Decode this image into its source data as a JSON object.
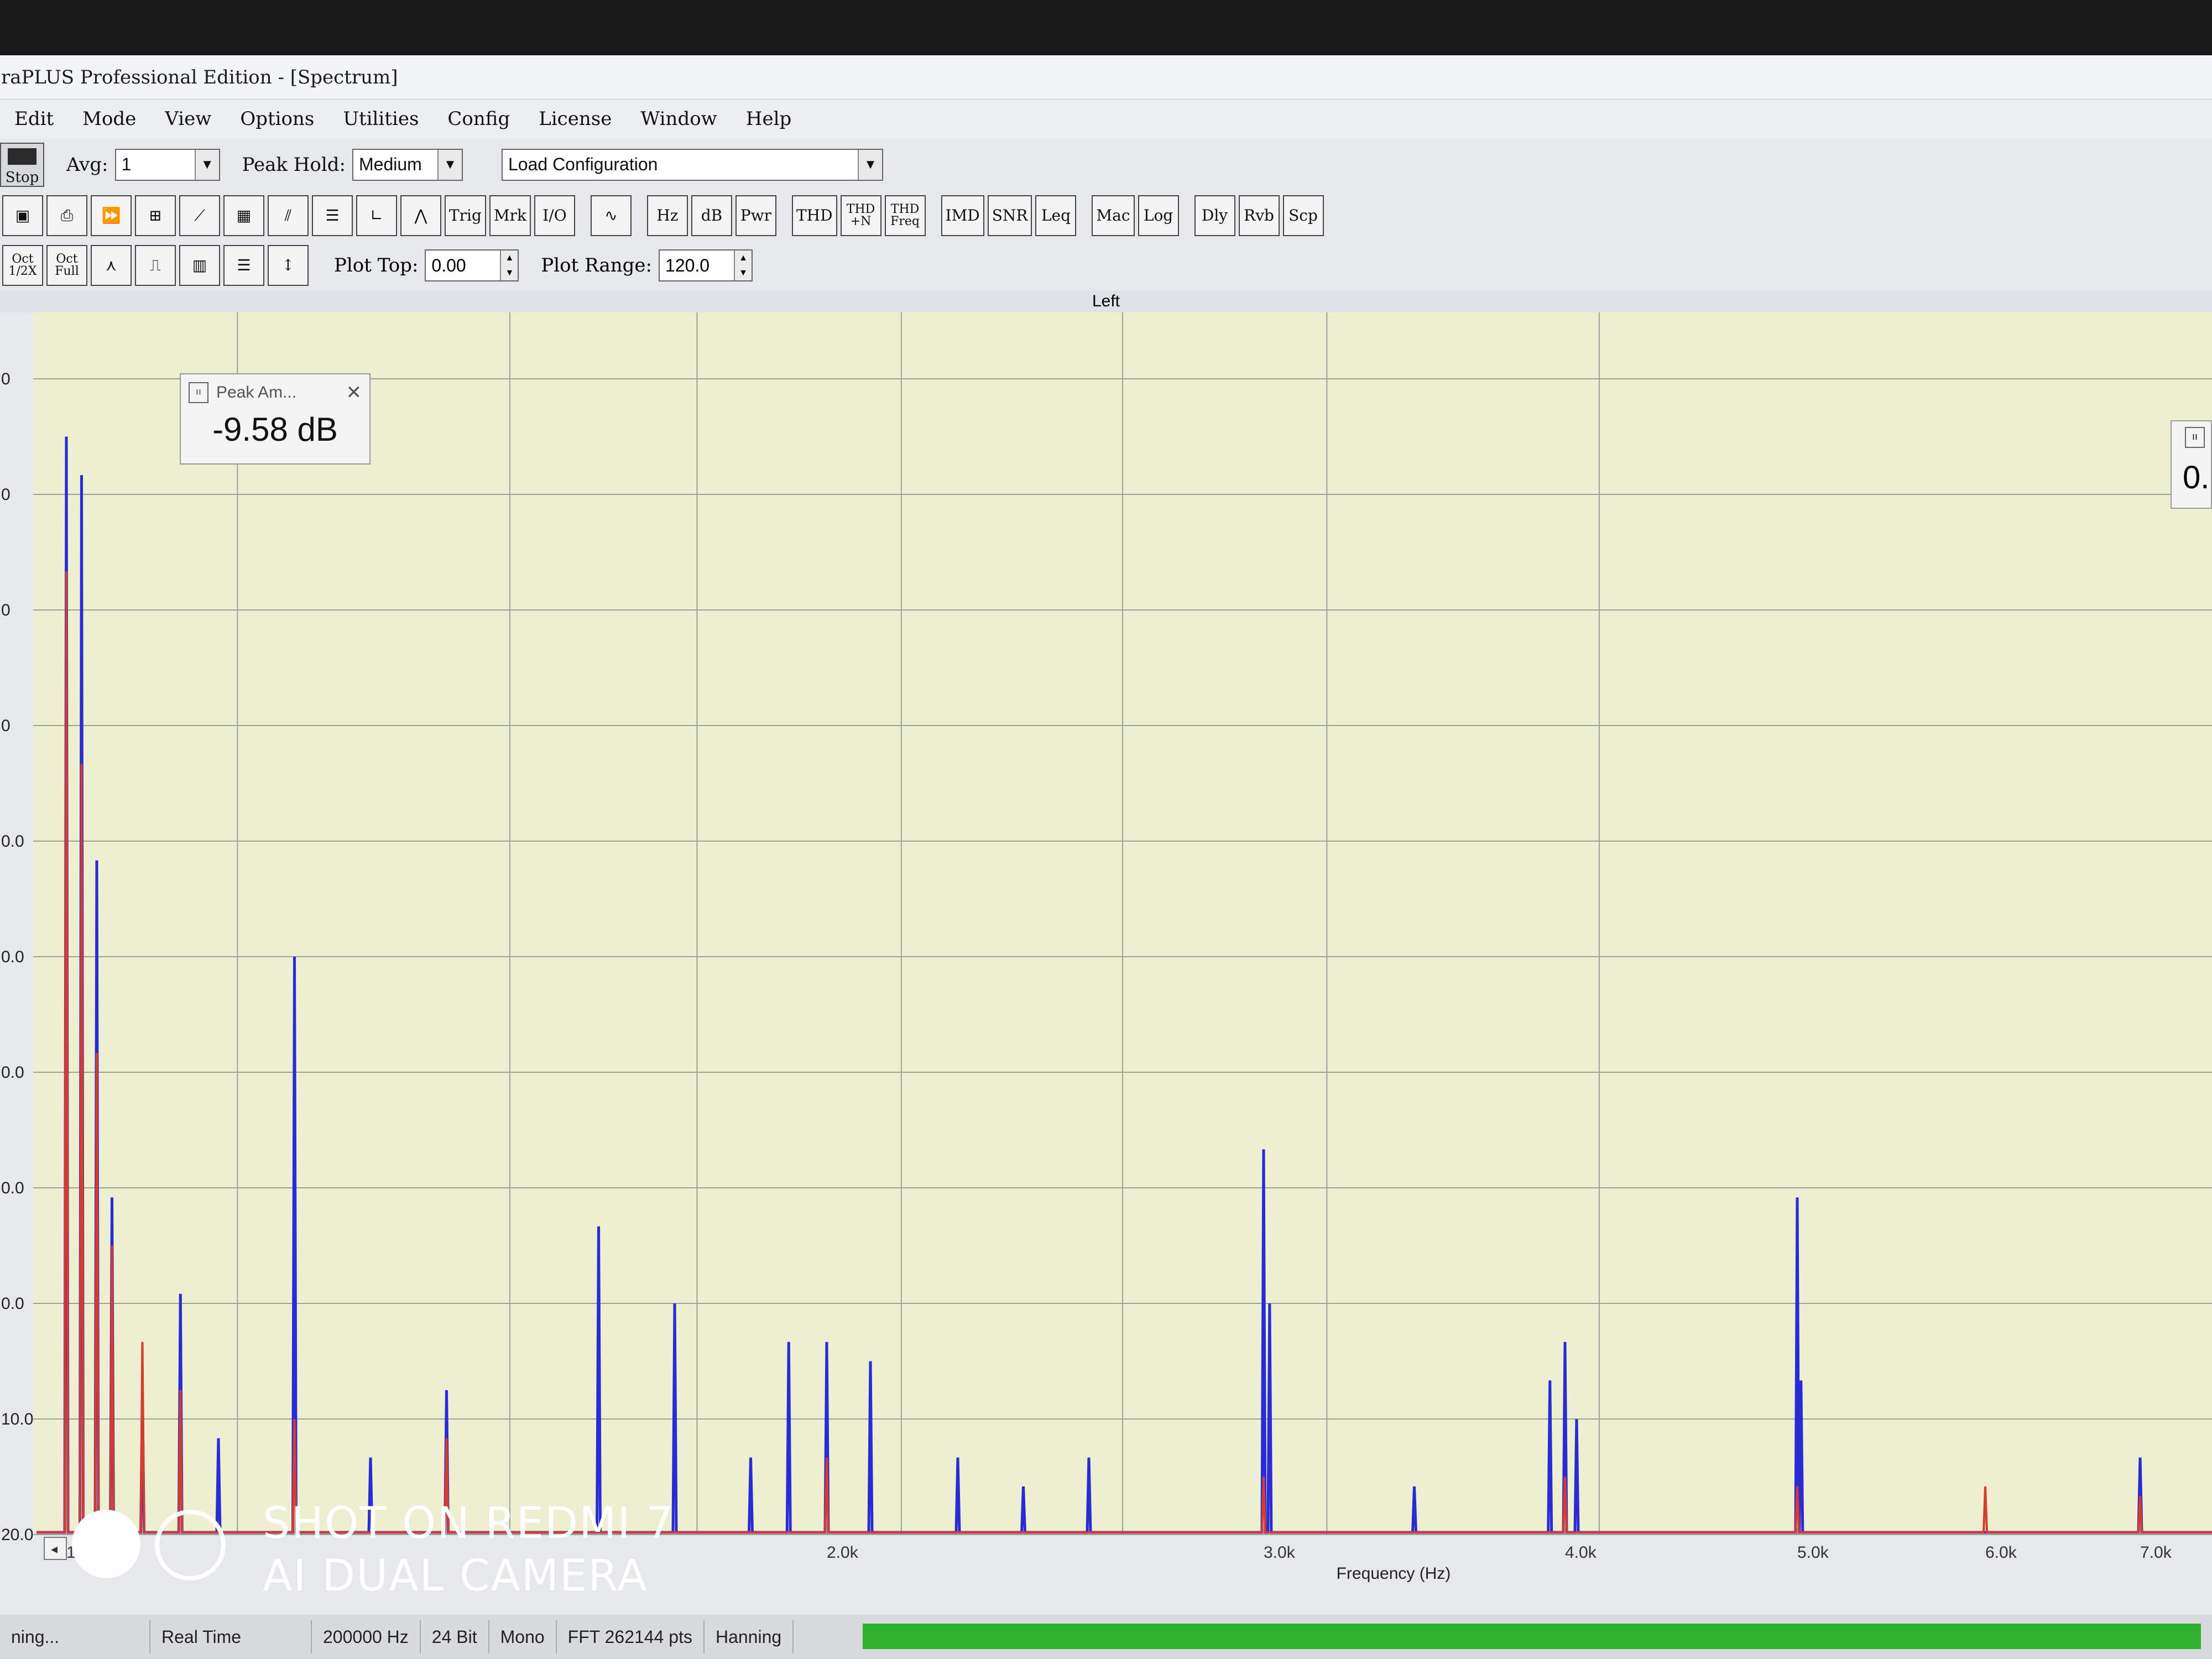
{
  "window": {
    "title": "raPLUS Professional Edition - [Spectrum]"
  },
  "menu": [
    "Edit",
    "Mode",
    "View",
    "Options",
    "Utilities",
    "Config",
    "License",
    "Window",
    "Help"
  ],
  "toolbar": {
    "stop_label": "Stop",
    "avg_label": "Avg:",
    "avg_value": "1",
    "peak_hold_label": "Peak Hold:",
    "peak_hold_value": "Medium",
    "config_value": "Load Configuration",
    "plot_top_label": "Plot Top:",
    "plot_top_value": "0.00",
    "plot_range_label": "Plot Range:",
    "plot_range_value": "120.0"
  },
  "tool_buttons_row2": [
    {
      "label": "",
      "icon": "save-icon"
    },
    {
      "label": "",
      "icon": "print-icon"
    },
    {
      "label": "",
      "icon": "fast-forward-icon"
    },
    {
      "label": "",
      "icon": "scope-icon"
    },
    {
      "label": "",
      "icon": "sawtooth-icon"
    },
    {
      "label": "",
      "icon": "spectrogram-icon"
    },
    {
      "label": "",
      "icon": "3d-plot-icon"
    },
    {
      "label": "",
      "icon": "list-icon"
    },
    {
      "label": "",
      "icon": "axis-icon"
    },
    {
      "label": "",
      "icon": "compass-icon"
    },
    {
      "label": "Trig",
      "icon": ""
    },
    {
      "label": "Mrk",
      "icon": ""
    },
    {
      "label": "I/O",
      "icon": ""
    },
    {
      "label": "",
      "icon": "sine-wave-icon"
    },
    {
      "label": "Hz",
      "icon": ""
    },
    {
      "label": "dB",
      "icon": ""
    },
    {
      "label": "Pwr",
      "icon": ""
    },
    {
      "label": "THD",
      "icon": ""
    },
    {
      "label": "THD +N",
      "icon": ""
    },
    {
      "label": "THD Freq",
      "icon": ""
    },
    {
      "label": "IMD",
      "icon": ""
    },
    {
      "label": "SNR",
      "icon": ""
    },
    {
      "label": "Leq",
      "icon": ""
    },
    {
      "label": "Mac",
      "icon": ""
    },
    {
      "label": "Log",
      "icon": ""
    },
    {
      "label": "Dly",
      "icon": ""
    },
    {
      "label": "Rvb",
      "icon": ""
    },
    {
      "label": "Scp",
      "icon": ""
    }
  ],
  "tool_buttons_row3": [
    {
      "label": "Oct 1/2X",
      "icon": ""
    },
    {
      "label": "Oct Full",
      "icon": ""
    },
    {
      "label": "",
      "icon": "peak-icon"
    },
    {
      "label": "",
      "icon": "step-response-icon"
    },
    {
      "label": "",
      "icon": "bar-spectrum-icon"
    },
    {
      "label": "",
      "icon": "list-icon"
    },
    {
      "label": "",
      "icon": "scale-icon"
    }
  ],
  "plot": {
    "channel_label": "Left",
    "peak_panel_title": "Peak Am...",
    "peak_value": "-9.58 dB",
    "right_panel_value": "0."
  },
  "chart_data": {
    "type": "line",
    "title": "",
    "xlabel": "Frequency (Hz)",
    "ylabel": "",
    "x_ticks": [
      "1.0k",
      "2.0k",
      "3.0k",
      "4.0k",
      "5.0k",
      "6.0k",
      "7.0k"
    ],
    "y_tick_labels_visible": [
      "0",
      "0",
      "0",
      "0",
      "0.0",
      "0.0",
      "0.0",
      "0.0",
      "0.0",
      "10.0",
      "20.0"
    ],
    "ylim": [
      -120,
      0
    ],
    "grid": true,
    "series": [
      {
        "color": "#2b2bd6",
        "x": [
          1000,
          1020,
          1040,
          1060,
          1100,
          1150,
          1200,
          1300,
          1400,
          1500,
          1700,
          1800,
          1900,
          1950,
          2000,
          2100,
          2300,
          2450,
          2600,
          3000,
          3020,
          3500,
          3950,
          4000,
          4050,
          5000,
          5020,
          7000
        ],
        "y": [
          -6,
          -10,
          -50,
          -85,
          -105,
          -95,
          -110,
          -60,
          -112,
          -105,
          -88,
          -96,
          -112,
          -100,
          -100,
          -102,
          -112,
          -115,
          -112,
          -80,
          -96,
          -115,
          -104,
          -100,
          -108,
          -85,
          -104,
          -112
        ]
      },
      {
        "color": "#d63b2b",
        "x": [
          1000,
          1020,
          1040,
          1060,
          1100,
          1150,
          1300,
          1500,
          2000,
          3000,
          4000,
          5000,
          6000,
          7000
        ],
        "y": [
          -20,
          -40,
          -70,
          -90,
          -100,
          -105,
          -108,
          -110,
          -112,
          -114,
          -114,
          -115,
          -115,
          -116
        ]
      }
    ]
  },
  "status": {
    "left": "ning...",
    "mode": "Real Time",
    "rate": "200000 Hz",
    "bits": "24 Bit",
    "channels": "Mono",
    "fft": "FFT 262144 pts",
    "window_fn": "Hanning"
  },
  "camera_watermark": {
    "line1": "SHOT ON REDMI 7",
    "line2": "AI DUAL CAMERA"
  },
  "colors": {
    "plot_bg": "#ecefd0",
    "grid": "#9aa29a",
    "trace_blue": "#2b2bd6",
    "trace_red": "#d63b2b",
    "progress": "#2fb02f"
  }
}
